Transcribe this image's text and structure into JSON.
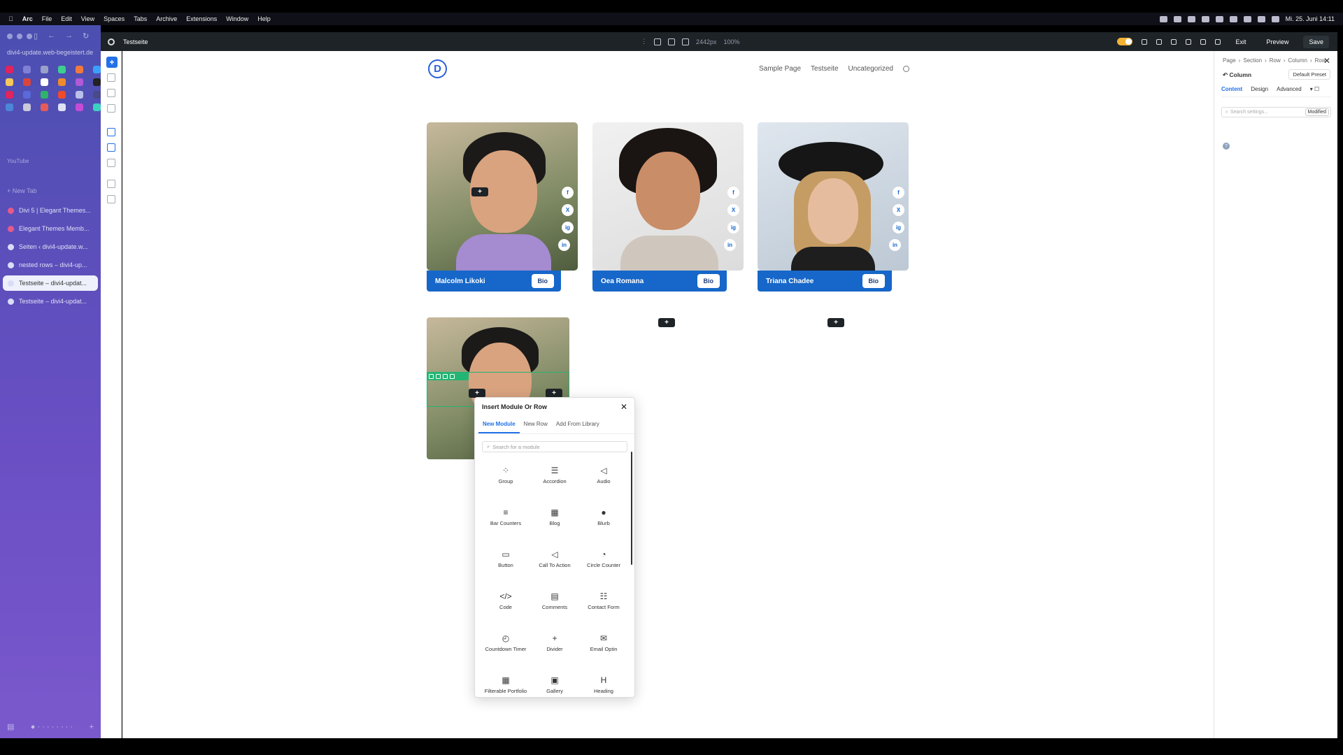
{
  "menubar": {
    "items": [
      "Arc",
      "File",
      "Edit",
      "View",
      "Spaces",
      "Tabs",
      "Archive",
      "Extensions",
      "Window",
      "Help"
    ],
    "clock": "Mi. 25. Juni 14:11"
  },
  "arc": {
    "url": "divi4-update.web-begeistert.de",
    "section": "YouTube",
    "new_tab": "New Tab",
    "tabs": [
      {
        "label": "Divi 5 | Elegant Themes...",
        "icon": "elegant-themes"
      },
      {
        "label": "Elegant Themes Memb...",
        "icon": "elegant-themes"
      },
      {
        "label": "Seiten ‹ divi4-update.w...",
        "icon": "wordpress"
      },
      {
        "label": "nested rows – divi4-up...",
        "icon": "wordpress"
      },
      {
        "label": "Testseite – divi4-updat...",
        "icon": "wordpress"
      },
      {
        "label": "Testseite – divi4-updat...",
        "icon": "wordpress"
      }
    ],
    "active_tab": 4
  },
  "builder": {
    "page_name": "Testseite",
    "width_readout": "2442px",
    "zoom": "100%",
    "exit": "Exit",
    "preview": "Preview",
    "save": "Save"
  },
  "site": {
    "logo": "D",
    "nav": [
      "Sample Page",
      "Testseite",
      "Uncategorized"
    ]
  },
  "team": [
    {
      "name": "Malcolm Likoki",
      "button": "Bio"
    },
    {
      "name": "Oea Romana",
      "button": "Bio"
    },
    {
      "name": "Triana Chadee",
      "button": "Bio"
    }
  ],
  "social_icons": [
    "f",
    "X",
    "ig",
    "in"
  ],
  "modal": {
    "title": "Insert Module Or Row",
    "tabs": [
      "New Module",
      "New Row",
      "Add From Library"
    ],
    "active_tab": 0,
    "search_placeholder": "Search for a module",
    "modules": [
      {
        "label": "Group",
        "glyph": "⁘"
      },
      {
        "label": "Accordion",
        "glyph": "☰"
      },
      {
        "label": "Audio",
        "glyph": "◁"
      },
      {
        "label": "Bar Counters",
        "glyph": "≡"
      },
      {
        "label": "Blog",
        "glyph": "▦"
      },
      {
        "label": "Blurb",
        "glyph": "●"
      },
      {
        "label": "Button",
        "glyph": "▭"
      },
      {
        "label": "Call To Action",
        "glyph": "◁"
      },
      {
        "label": "Circle Counter",
        "glyph": "◔"
      },
      {
        "label": "Code",
        "glyph": "</>"
      },
      {
        "label": "Comments",
        "glyph": "▤"
      },
      {
        "label": "Contact Form",
        "glyph": "☷"
      },
      {
        "label": "Countdown Timer",
        "glyph": "◴"
      },
      {
        "label": "Divider",
        "glyph": "+"
      },
      {
        "label": "Email Optin",
        "glyph": "✉"
      },
      {
        "label": "Filterable Portfolio",
        "glyph": "▦"
      },
      {
        "label": "Gallery",
        "glyph": "▣"
      },
      {
        "label": "Heading",
        "glyph": "H"
      }
    ]
  },
  "panel": {
    "breadcrumb": [
      "Page",
      "Section",
      "Row",
      "Column",
      "Row"
    ],
    "title": "Column",
    "preset": "Default Preset",
    "tabs": [
      "Content",
      "Design",
      "Advanced"
    ],
    "search_placeholder": "Search settings...",
    "filter": "Modified"
  },
  "colors": {
    "accent": "#2271e8",
    "card_bar": "#1667c9",
    "builder_dark": "#1d2327",
    "module_toolbar": "#22b573"
  }
}
